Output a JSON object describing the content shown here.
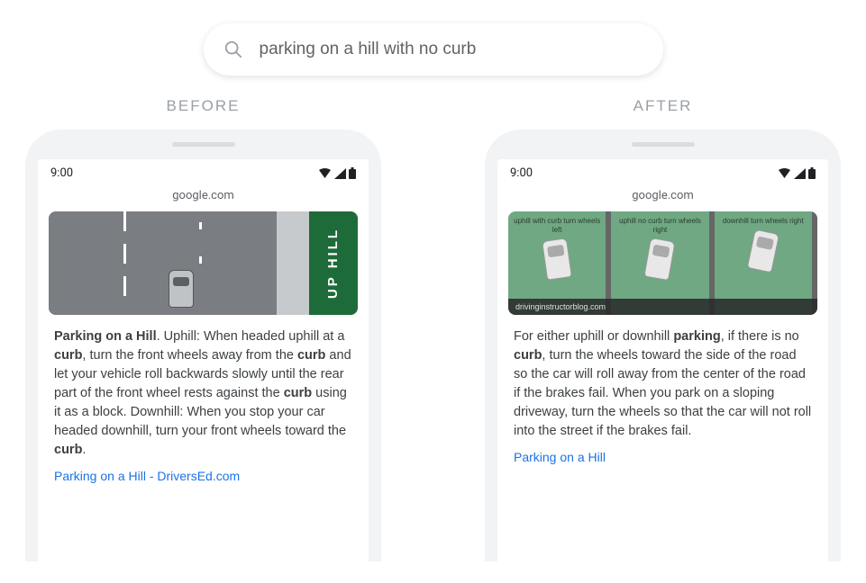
{
  "search": {
    "query": "parking on a hill with no curb"
  },
  "labels": {
    "before": "BEFORE",
    "after": "AFTER"
  },
  "phone": {
    "time": "9:00",
    "url": "google.com"
  },
  "before": {
    "image": {
      "uphill_label": "UP HILL"
    },
    "snippet_html": "<b>Parking on a Hill</b>. Uphill: When headed uphill at a <b>curb</b>, turn the front wheels away from the <b>curb</b> and let your vehicle roll backwards slowly until the rear part of the front wheel rests against the <b>curb</b> using it as a block. Downhill: When you stop your car headed downhill, turn your front wheels toward the <b>curb</b>.",
    "link": "Parking on a Hill - DriversEd.com"
  },
  "after": {
    "image": {
      "panels": [
        {
          "caption": "uphill with curb\nturn wheels left"
        },
        {
          "caption": "uphill no curb\nturn wheels right"
        },
        {
          "caption": "downhill\nturn wheels right"
        }
      ],
      "credit": "drivinginstructorblog.com"
    },
    "snippet_html": "For either uphill or downhill <b>parking</b>, if there is no <b>curb</b>, turn the wheels toward the side of the road so the car will roll away from the center of the road if the brakes fail. When you park on a sloping driveway, turn the wheels so that the car will not roll into the street if the brakes fail.",
    "link": "Parking on a Hill"
  }
}
